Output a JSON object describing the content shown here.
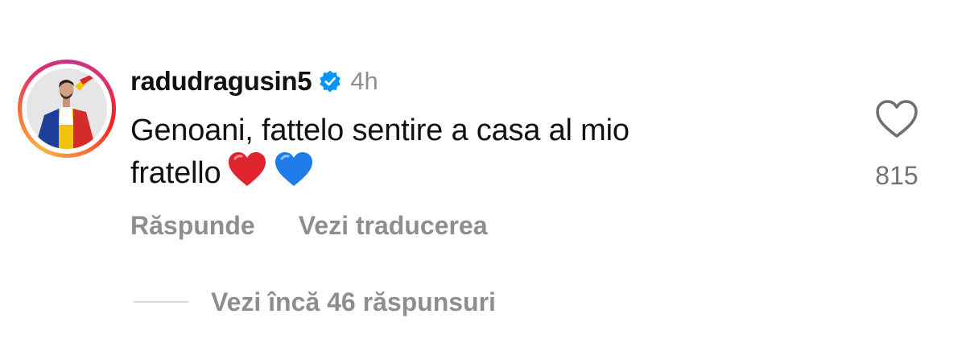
{
  "comment": {
    "username": "radudragusin5",
    "verified_icon": "verified-badge-icon",
    "timestamp": "4h",
    "text_line1": "Genoani, fattelo sentire a casa al mio",
    "text_line2": "fratello",
    "emojis": [
      "red-heart-icon",
      "blue-heart-icon"
    ],
    "like_count": "815",
    "like_icon": "heart-outline-icon"
  },
  "actions": {
    "reply_label": "Răspunde",
    "translate_label": "Vezi traducerea"
  },
  "replies": {
    "label": "Vezi încă 46 răspunsuri"
  },
  "colors": {
    "verified": "#0095f6",
    "muted_text": "#8e8e8e",
    "red_heart": "#e0242e",
    "blue_heart": "#1f7be8"
  }
}
